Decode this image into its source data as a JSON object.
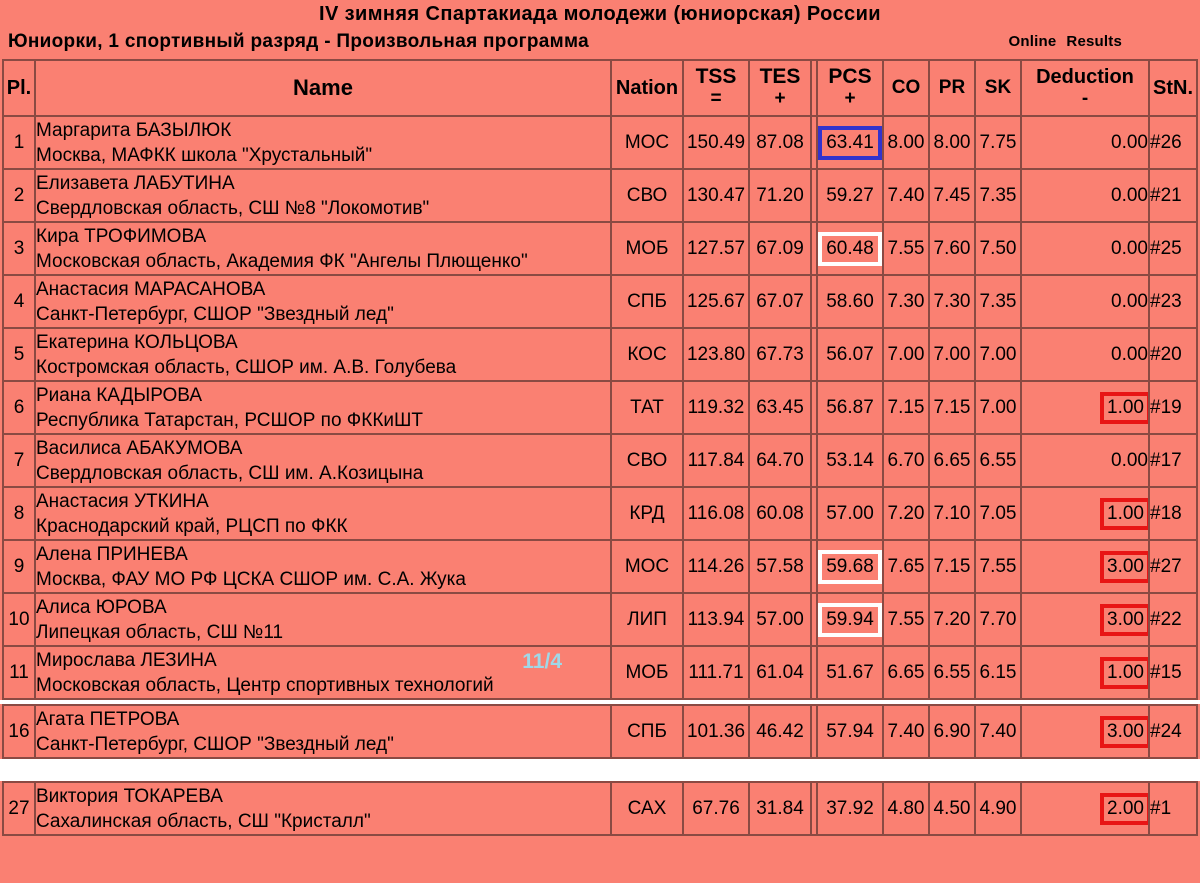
{
  "header": {
    "main_title": "IV зимняя  Спартакиада  молодежи  (юниорская)  России",
    "sub_title": "Юниорки, 1  спортивный разряд -  Произвольная программа",
    "online_label": "Online",
    "results_label": "Results"
  },
  "colors": {
    "page_background": "#fa8072",
    "grid_line": "#8a4a43",
    "highlight_blue": "#3333cc",
    "highlight_white": "#ffffff",
    "highlight_red": "#e81515",
    "badge_text": "#9fd8e8",
    "separator": "#ffffff"
  },
  "columns": [
    {
      "key": "pl",
      "label": "Pl.",
      "sub": ""
    },
    {
      "key": "name",
      "label": "Name",
      "sub": ""
    },
    {
      "key": "nation",
      "label": "Nation",
      "sub": ""
    },
    {
      "key": "tss",
      "label": "TSS",
      "sub": "="
    },
    {
      "key": "tes",
      "label": "TES",
      "sub": "+"
    },
    {
      "key": "pcs",
      "label": "PCS",
      "sub": "+"
    },
    {
      "key": "co",
      "label": "CO",
      "sub": ""
    },
    {
      "key": "pr",
      "label": "PR",
      "sub": ""
    },
    {
      "key": "sk",
      "label": "SK",
      "sub": ""
    },
    {
      "key": "ded",
      "label": "Deduction",
      "sub": "-"
    },
    {
      "key": "stn",
      "label": "StN.",
      "sub": ""
    }
  ],
  "sections": [
    {
      "id": "section-main",
      "rows": [
        {
          "pl": "1",
          "name": "Маргарита БАЗЫЛЮК",
          "club": "Москва, МАФКК школа \"Хрустальный\"",
          "badge": "",
          "nation": "МОС",
          "tss": "150.49",
          "tes": "87.08",
          "pcs": "63.41",
          "co": "8.00",
          "pr": "8.00",
          "sk": "7.75",
          "ded": "0.00",
          "stn": "#26",
          "pcs_box": "blue",
          "ded_box": "none"
        },
        {
          "pl": "2",
          "name": "Елизавета ЛАБУТИНА",
          "club": "Свердловская область, СШ №8 \"Локомотив\"",
          "badge": "",
          "nation": "СВО",
          "tss": "130.47",
          "tes": "71.20",
          "pcs": "59.27",
          "co": "7.40",
          "pr": "7.45",
          "sk": "7.35",
          "ded": "0.00",
          "stn": "#21",
          "pcs_box": "none",
          "ded_box": "none"
        },
        {
          "pl": "3",
          "name": "Кира ТРОФИМОВА",
          "club": "Московская область, Академия ФК \"Ангелы Плющенко\"",
          "badge": "",
          "nation": "МОБ",
          "tss": "127.57",
          "tes": "67.09",
          "pcs": "60.48",
          "co": "7.55",
          "pr": "7.60",
          "sk": "7.50",
          "ded": "0.00",
          "stn": "#25",
          "pcs_box": "white",
          "ded_box": "none"
        },
        {
          "pl": "4",
          "name": "Анастасия МАРАСАНОВА",
          "club": "Санкт-Петербург, СШОР \"Звездный лед\"",
          "badge": "",
          "nation": "СПБ",
          "tss": "125.67",
          "tes": "67.07",
          "pcs": "58.60",
          "co": "7.30",
          "pr": "7.30",
          "sk": "7.35",
          "ded": "0.00",
          "stn": "#23",
          "pcs_box": "none",
          "ded_box": "none"
        },
        {
          "pl": "5",
          "name": "Екатерина КОЛЬЦОВА",
          "club": "Костромская область, СШОР им. А.В. Голубева",
          "badge": "",
          "nation": "КОС",
          "tss": "123.80",
          "tes": "67.73",
          "pcs": "56.07",
          "co": "7.00",
          "pr": "7.00",
          "sk": "7.00",
          "ded": "0.00",
          "stn": "#20",
          "pcs_box": "none",
          "ded_box": "none"
        },
        {
          "pl": "6",
          "name": "Риана КАДЫРОВА",
          "club": "Республика Татарстан, РСШОР по ФККиШТ",
          "badge": "",
          "nation": "ТАТ",
          "tss": "119.32",
          "tes": "63.45",
          "pcs": "56.87",
          "co": "7.15",
          "pr": "7.15",
          "sk": "7.00",
          "ded": "1.00",
          "stn": "#19",
          "pcs_box": "none",
          "ded_box": "red"
        },
        {
          "pl": "7",
          "name": "Василиса АБАКУМОВА",
          "club": "Свердловская область, СШ им. А.Козицына",
          "badge": "",
          "nation": "СВО",
          "tss": "117.84",
          "tes": "64.70",
          "pcs": "53.14",
          "co": "6.70",
          "pr": "6.65",
          "sk": "6.55",
          "ded": "0.00",
          "stn": "#17",
          "pcs_box": "none",
          "ded_box": "none"
        },
        {
          "pl": "8",
          "name": "Анастасия УТКИНА",
          "club": "Краснодарский край, РЦСП по ФКК",
          "badge": "",
          "nation": "КРД",
          "tss": "116.08",
          "tes": "60.08",
          "pcs": "57.00",
          "co": "7.20",
          "pr": "7.10",
          "sk": "7.05",
          "ded": "1.00",
          "stn": "#18",
          "pcs_box": "none",
          "ded_box": "red"
        },
        {
          "pl": "9",
          "name": "Алена ПРИНЕВА",
          "club": "Москва, ФАУ МО РФ ЦСКА СШОР им. С.А. Жука",
          "badge": "",
          "nation": "МОС",
          "tss": "114.26",
          "tes": "57.58",
          "pcs": "59.68",
          "co": "7.65",
          "pr": "7.15",
          "sk": "7.55",
          "ded": "3.00",
          "stn": "#27",
          "pcs_box": "white",
          "ded_box": "red"
        },
        {
          "pl": "10",
          "name": "Алиса ЮРОВА",
          "club": "Липецкая область, СШ №11",
          "badge": "",
          "nation": "ЛИП",
          "tss": "113.94",
          "tes": "57.00",
          "pcs": "59.94",
          "co": "7.55",
          "pr": "7.20",
          "sk": "7.70",
          "ded": "3.00",
          "stn": "#22",
          "pcs_box": "white",
          "ded_box": "red"
        },
        {
          "pl": "11",
          "name": "Мирослава ЛЕЗИНА",
          "club": "Московская область, Центр спортивных технологий",
          "badge": "11/4",
          "nation": "МОБ",
          "tss": "111.71",
          "tes": "61.04",
          "pcs": "51.67",
          "co": "6.65",
          "pr": "6.55",
          "sk": "6.15",
          "ded": "1.00",
          "stn": "#15",
          "pcs_box": "none",
          "ded_box": "red"
        }
      ]
    },
    {
      "id": "section-second",
      "rows": [
        {
          "pl": "16",
          "name": "Агата ПЕТРОВА",
          "club": "Санкт-Петербург, СШОР \"Звездный лед\"",
          "badge": "",
          "nation": "СПБ",
          "tss": "101.36",
          "tes": "46.42",
          "pcs": "57.94",
          "co": "7.40",
          "pr": "6.90",
          "sk": "7.40",
          "ded": "3.00",
          "stn": "#24",
          "pcs_box": "none",
          "ded_box": "red"
        }
      ]
    },
    {
      "id": "section-third",
      "rows": [
        {
          "pl": "27",
          "name": "Виктория ТОКАРЕВА",
          "club": "Сахалинская область, СШ \"Кристалл\"",
          "badge": "",
          "nation": "САХ",
          "tss": "67.76",
          "tes": "31.84",
          "pcs": "37.92",
          "co": "4.80",
          "pr": "4.50",
          "sk": "4.90",
          "ded": "2.00",
          "stn": "#1",
          "pcs_box": "none",
          "ded_box": "red"
        }
      ]
    }
  ]
}
